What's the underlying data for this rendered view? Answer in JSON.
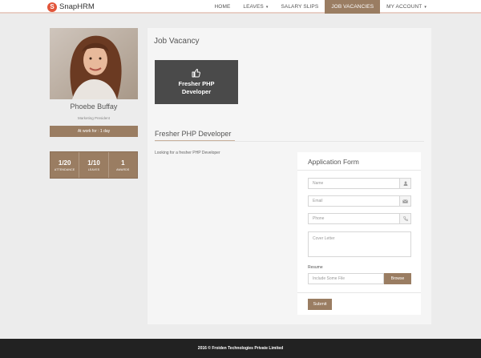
{
  "brand": {
    "name": "SnapHRM",
    "badge": "S"
  },
  "nav": {
    "items": [
      {
        "label": "HOME"
      },
      {
        "label": "LEAVES",
        "caret": "▾"
      },
      {
        "label": "SALARY SLIPS"
      },
      {
        "label": "JOB VACANCIES",
        "active": true
      },
      {
        "label": "MY ACCOUNT",
        "caret": "▾"
      }
    ]
  },
  "profile": {
    "name": "Phoebe Buffay",
    "role": "Marketing President",
    "at_work": "At work for : 1 day",
    "stats": [
      {
        "value": "1/20",
        "label": "ATTENDANCE"
      },
      {
        "value": "1/10",
        "label": "LEAVES"
      },
      {
        "value": "1",
        "label": "AWARDS"
      }
    ]
  },
  "main": {
    "title": "Job Vacancy",
    "vacancy_card": {
      "line1": "Fresher PHP",
      "line2": "Developer"
    },
    "section_title": "Fresher PHP Developer",
    "description": "Looking for a fresher PHP Developer"
  },
  "form": {
    "title": "Application Form",
    "name_placeholder": "Name",
    "email_placeholder": "Email",
    "phone_placeholder": "Phone",
    "cover_placeholder": "Cover Letter",
    "resume_label": "Resume",
    "file_placeholder": "Include Some File",
    "browse_label": "Browse",
    "submit_label": "Submit"
  },
  "footer": {
    "text": "2016 © Froiden Technologies Private Limited"
  },
  "colors": {
    "accent": "#9a7d62",
    "dark": "#4a4a4a",
    "footer": "#222222",
    "logo": "#e2553a"
  }
}
